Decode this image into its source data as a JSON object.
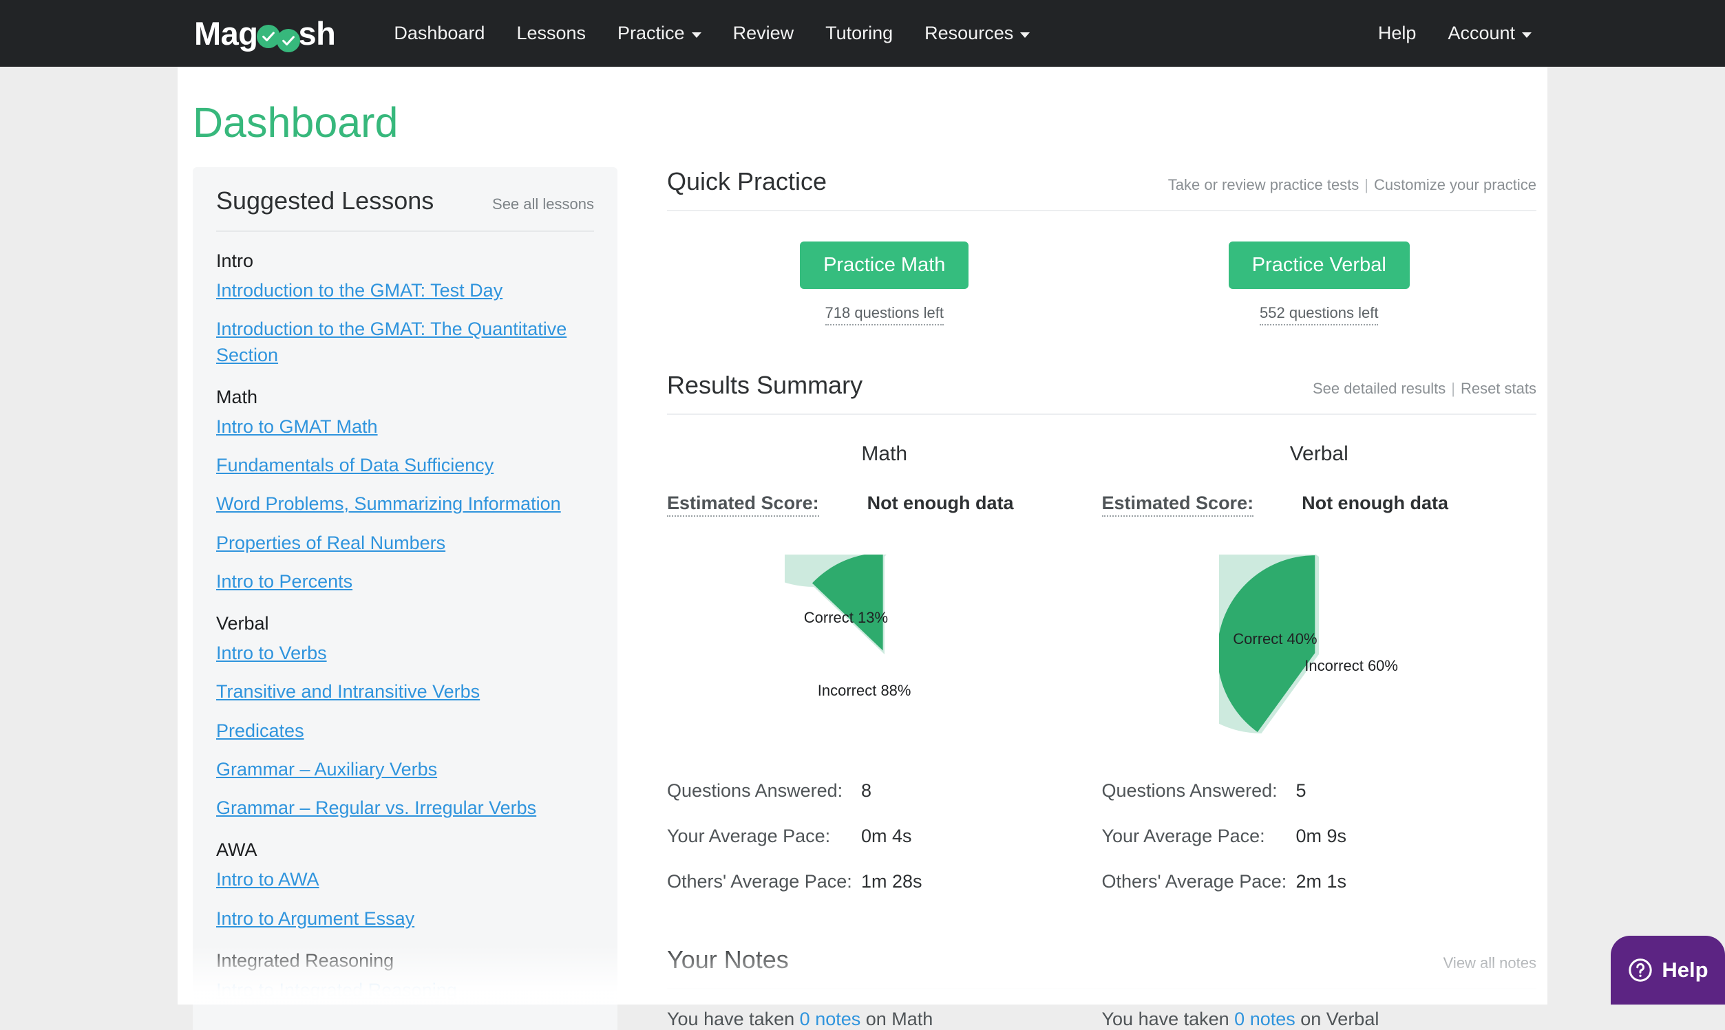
{
  "navbar": {
    "logo": {
      "prefix": "Mag",
      "suffix": "sh",
      "icon": "double-check-icon"
    },
    "links": [
      {
        "label": "Dashboard",
        "caret": false
      },
      {
        "label": "Lessons",
        "caret": false
      },
      {
        "label": "Practice",
        "caret": true
      },
      {
        "label": "Review",
        "caret": false
      },
      {
        "label": "Tutoring",
        "caret": false
      },
      {
        "label": "Resources",
        "caret": true
      }
    ],
    "right_links": [
      {
        "label": "Help",
        "caret": false
      },
      {
        "label": "Account",
        "caret": true
      }
    ]
  },
  "page": {
    "title": "Dashboard"
  },
  "sidebar": {
    "title": "Suggested Lessons",
    "see_all_label": "See all lessons",
    "groups": [
      {
        "name": "Intro",
        "lessons": [
          "Introduction to the GMAT: Test Day",
          "Introduction to the GMAT: The Quantitative Section"
        ]
      },
      {
        "name": "Math",
        "lessons": [
          "Intro to GMAT Math",
          "Fundamentals of Data Sufficiency",
          "Word Problems, Summarizing Information",
          "Properties of Real Numbers",
          "Intro to Percents"
        ]
      },
      {
        "name": "Verbal",
        "lessons": [
          "Intro to Verbs",
          "Transitive and Intransitive Verbs",
          "Predicates",
          "Grammar – Auxiliary Verbs",
          "Grammar – Regular vs. Irregular Verbs"
        ]
      },
      {
        "name": "AWA",
        "lessons": [
          "Intro to AWA",
          "Intro to Argument Essay"
        ]
      },
      {
        "name": "Integrated Reasoning",
        "lessons": [
          "Intro to Integrated Reasoning"
        ]
      }
    ]
  },
  "quick_practice": {
    "title": "Quick Practice",
    "links": [
      {
        "label": "Take or review practice tests"
      },
      {
        "label": "Customize your practice"
      }
    ],
    "separator": "|",
    "columns": [
      {
        "button_label": "Practice Math",
        "questions_left": "718 questions left"
      },
      {
        "button_label": "Practice Verbal",
        "questions_left": "552 questions left"
      }
    ]
  },
  "results_summary": {
    "title": "Results Summary",
    "links": [
      {
        "label": "See detailed results"
      },
      {
        "label": "Reset stats"
      }
    ],
    "separator": "|",
    "columns": [
      {
        "name": "Math",
        "estimated_score_label": "Estimated Score:",
        "estimated_score_value": "Not enough data",
        "stats": [
          {
            "label": "Questions Answered:",
            "value": "8"
          },
          {
            "label": "Your Average Pace:",
            "value": "0m 4s"
          },
          {
            "label": "Others' Average Pace:",
            "value": "1m 28s"
          }
        ]
      },
      {
        "name": "Verbal",
        "estimated_score_label": "Estimated Score:",
        "estimated_score_value": "Not enough data",
        "stats": [
          {
            "label": "Questions Answered:",
            "value": "5"
          },
          {
            "label": "Your Average Pace:",
            "value": "0m 9s"
          },
          {
            "label": "Others' Average Pace:",
            "value": "2m 1s"
          }
        ]
      }
    ]
  },
  "chart_data": [
    {
      "type": "pie",
      "title": "Math",
      "labels": [
        "Correct",
        "Incorrect"
      ],
      "values": [
        13,
        88
      ],
      "display_labels": [
        "Correct 13%",
        "Incorrect 88%"
      ],
      "colors": [
        "#2eab6d",
        "#cdeade"
      ],
      "exploded_slice": "Correct",
      "start_angle_deg": 0,
      "direction": "counterclockwise",
      "legend": "none"
    },
    {
      "type": "pie",
      "title": "Verbal",
      "labels": [
        "Correct",
        "Incorrect"
      ],
      "values": [
        40,
        60
      ],
      "display_labels": [
        "Correct 40%",
        "Incorrect 60%"
      ],
      "colors": [
        "#2eab6d",
        "#cdeade"
      ],
      "exploded_slice": "Correct",
      "start_angle_deg": 0,
      "direction": "counterclockwise",
      "legend": "none"
    }
  ],
  "notes": {
    "title": "Your Notes",
    "view_all_label": "View all notes",
    "columns": [
      {
        "prefix": "You have taken ",
        "link": "0 notes",
        "suffix": " on Math"
      },
      {
        "prefix": "You have taken ",
        "link": "0 notes",
        "suffix": " on Verbal"
      }
    ]
  },
  "help_widget": {
    "label": "Help",
    "icon": "question-circle-icon"
  },
  "colors": {
    "brand_green": "#37b87c",
    "button_green": "#35bd7e",
    "pie_dark": "#2eab6d",
    "pie_light": "#cdeade",
    "link_blue": "#2f94dd",
    "navbar_dark": "#222426",
    "help_purple": "#5c2483"
  }
}
